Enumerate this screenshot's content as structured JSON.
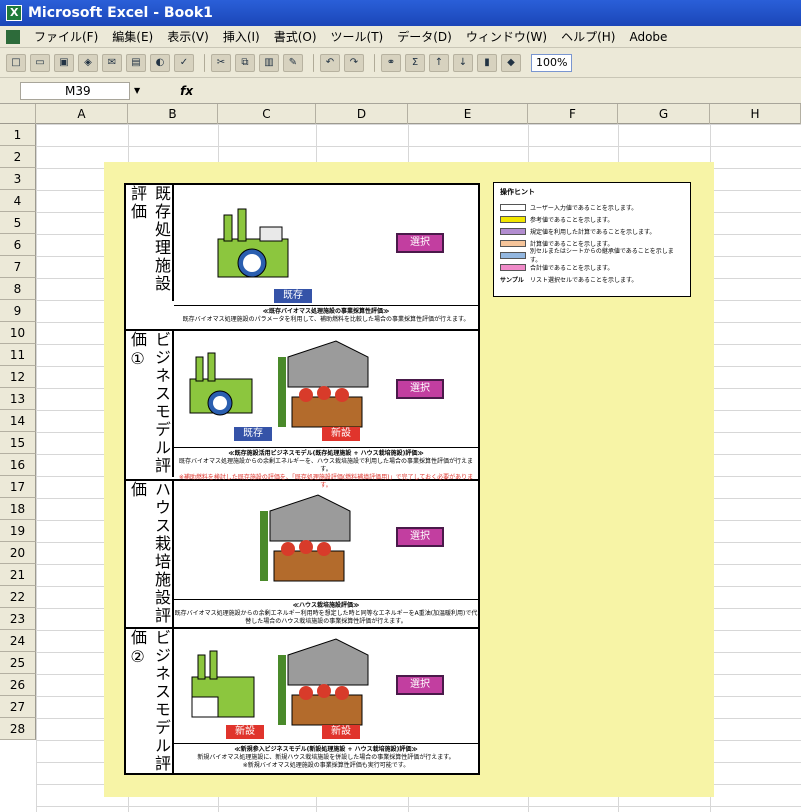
{
  "window": {
    "title": "Microsoft Excel - Book1"
  },
  "menu": [
    "ファイル(F)",
    "編集(E)",
    "表示(V)",
    "挿入(I)",
    "書式(O)",
    "ツール(T)",
    "データ(D)",
    "ウィンドウ(W)",
    "ヘルプ(H)",
    "Adobe"
  ],
  "toolbar": {
    "zoom": "100%"
  },
  "formula": {
    "cell": "M39",
    "fx": "fx"
  },
  "columns": [
    "A",
    "B",
    "C",
    "D",
    "E",
    "F",
    "G",
    "H"
  ],
  "rows": [
    "1",
    "2",
    "3",
    "4",
    "5",
    "6",
    "7",
    "8",
    "9",
    "10",
    "11",
    "12",
    "13",
    "14",
    "15",
    "16",
    "17",
    "18",
    "19",
    "20",
    "21",
    "22",
    "23",
    "24",
    "25",
    "26",
    "27",
    "28"
  ],
  "sections": [
    {
      "label": "既存処理施設評価",
      "caption1": "≪既存バイオマス処理施設の事業採算性評価≫",
      "caption2": "既存バイオマス処理施設のパラメータを利用して、補助燃料を比較した場合の事業採算性評価が行えます。",
      "caption3": "",
      "button": "選択",
      "tags": [
        "既存"
      ]
    },
    {
      "label": "ビジネスモデル評価①",
      "caption1": "≪既存施設活用ビジネスモデル(既存処理施設 + ハウス栽培施設)評価≫",
      "caption2": "既存バイオマス処理施設からの余剰エネルギーを、ハウス栽培施設で利用した場合の事業採算性評価が行えます。",
      "caption3": "※補助燃料を検討した既存施設の評価を、「既存処理施設評価(燃料補填評価用)」で完了しておく必要があります。",
      "button": "選択",
      "tags": [
        "既存",
        "新設"
      ]
    },
    {
      "label": "ハウス栽培施設評価",
      "caption1": "≪ハウス栽培施設評価≫",
      "caption2": "既存バイオマス処理施設からの余剰エネルギー利用時を想定した時と同等なエネルギーをA重油(加温暖利用)で代替した場合のハウス栽培施設の事業採算性評価が行えます。",
      "caption3": "",
      "button": "選択",
      "tags": []
    },
    {
      "label": "ビジネスモデル評価②",
      "caption1": "≪新規参入ビジネスモデル(新設処理施設 + ハウス栽培施設)評価≫",
      "caption2": "新規バイオマス処理施設に、新規ハウス栽培施設を併設した場合の事業採算性評価が行えます。",
      "caption3": "※新規バイオマス処理施設の事業採算性評価も実行可能です。",
      "button": "選択",
      "tags": [
        "新設",
        "新設"
      ]
    }
  ],
  "hint": {
    "title": "操作ヒント",
    "items": [
      {
        "text": "ユーザー入力値であることを示します。",
        "color": "#ffffff"
      },
      {
        "text": "参考値であることを示します。",
        "color": "#f2e600"
      },
      {
        "text": "規定値を利用した計算であることを示します。",
        "color": "#b28dd0"
      },
      {
        "text": "計算値であることを示します。",
        "color": "#f5c49a"
      },
      {
        "text": "別セルまたはシートからの継承値であることを示します。",
        "color": "#93b7e0"
      },
      {
        "text": "合計値であることを示します。",
        "color": "#ef8ac8"
      },
      {
        "text": "リスト選択セルであることを示します。",
        "color": "",
        "sample": "サンプル"
      }
    ]
  }
}
